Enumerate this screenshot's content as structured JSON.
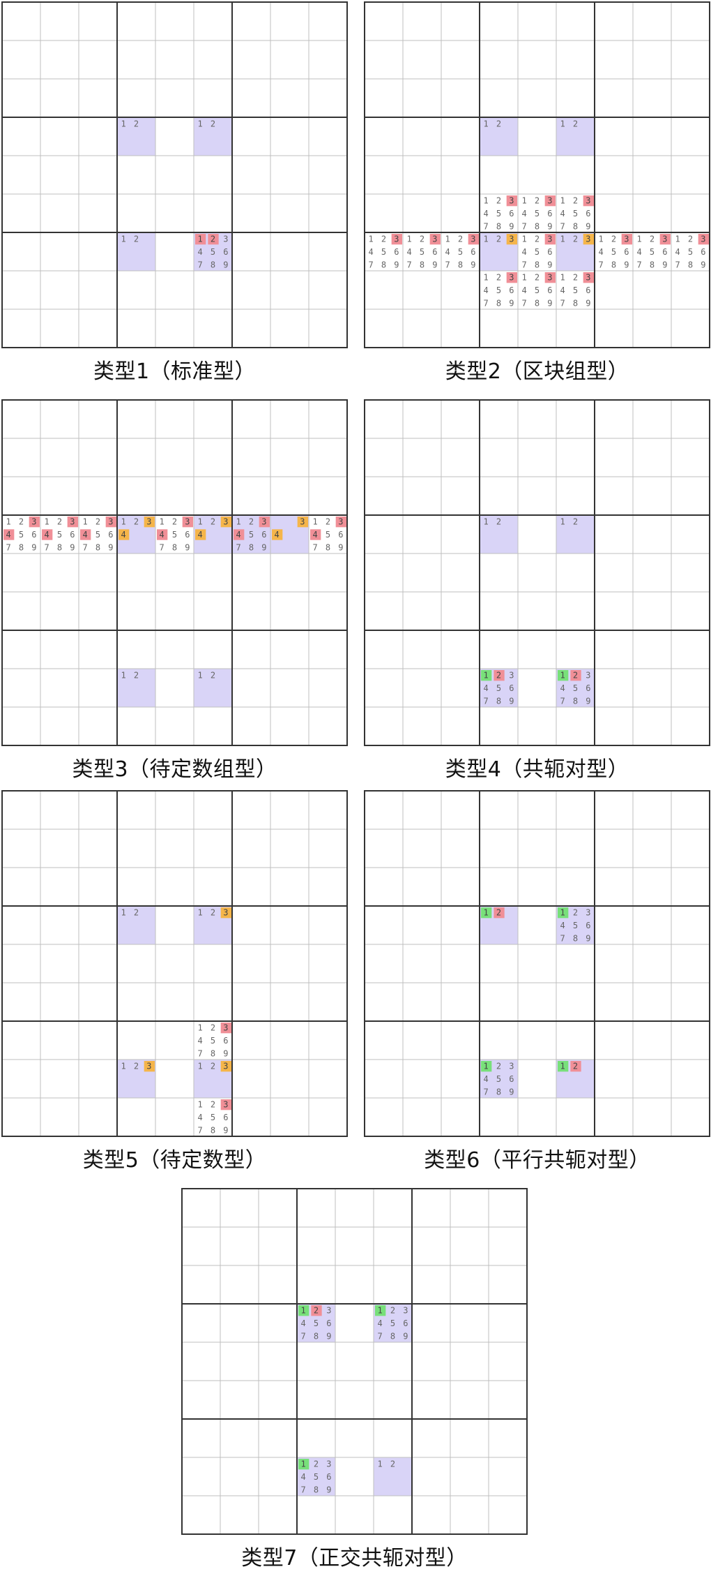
{
  "colors": {
    "highlight": "#d9d4f7",
    "red": "#f08f97",
    "orange": "#f5b54a",
    "green": "#78e07a",
    "grid_thin": "#bfbfbf",
    "grid_thick": "#333333",
    "digit": "#666666"
  },
  "panels": [
    {
      "title": "类型1（标准型）",
      "highlights": [
        [
          3,
          3
        ],
        [
          3,
          5
        ],
        [
          6,
          3
        ],
        [
          6,
          5
        ]
      ],
      "cells": [
        {
          "r": 3,
          "c": 3,
          "d": [
            1,
            2
          ]
        },
        {
          "r": 3,
          "c": 5,
          "d": [
            1,
            2
          ]
        },
        {
          "r": 6,
          "c": 3,
          "d": [
            1,
            2
          ]
        },
        {
          "r": 6,
          "c": 5,
          "d": [
            1,
            2,
            3,
            4,
            5,
            6,
            7,
            8,
            9
          ],
          "mark": {
            "1": "red",
            "2": "red"
          }
        }
      ]
    },
    {
      "title": "类型2（区块组型）",
      "highlights": [
        [
          3,
          3
        ],
        [
          3,
          5
        ],
        [
          6,
          3
        ],
        [
          6,
          5
        ]
      ],
      "cells": [
        {
          "r": 3,
          "c": 3,
          "d": [
            1,
            2
          ]
        },
        {
          "r": 3,
          "c": 5,
          "d": [
            1,
            2
          ]
        },
        {
          "r": 5,
          "c": 3,
          "d": [
            1,
            2,
            3,
            4,
            5,
            6,
            7,
            8,
            9
          ],
          "mark": {
            "3": "red"
          }
        },
        {
          "r": 5,
          "c": 4,
          "d": [
            1,
            2,
            3,
            4,
            5,
            6,
            7,
            8,
            9
          ],
          "mark": {
            "3": "red"
          }
        },
        {
          "r": 5,
          "c": 5,
          "d": [
            1,
            2,
            3,
            4,
            5,
            6,
            7,
            8,
            9
          ],
          "mark": {
            "3": "red"
          }
        },
        {
          "r": 6,
          "c": 0,
          "d": [
            1,
            2,
            3,
            4,
            5,
            6,
            7,
            8,
            9
          ],
          "mark": {
            "3": "red"
          }
        },
        {
          "r": 6,
          "c": 1,
          "d": [
            1,
            2,
            3,
            4,
            5,
            6,
            7,
            8,
            9
          ],
          "mark": {
            "3": "red"
          }
        },
        {
          "r": 6,
          "c": 2,
          "d": [
            1,
            2,
            3,
            4,
            5,
            6,
            7,
            8,
            9
          ],
          "mark": {
            "3": "red"
          }
        },
        {
          "r": 6,
          "c": 3,
          "d": [
            1,
            2,
            3
          ],
          "mark": {
            "3": "orange"
          }
        },
        {
          "r": 6,
          "c": 4,
          "d": [
            1,
            2,
            3,
            4,
            5,
            6,
            7,
            8,
            9
          ],
          "mark": {
            "3": "red"
          }
        },
        {
          "r": 6,
          "c": 5,
          "d": [
            1,
            2,
            3
          ],
          "mark": {
            "3": "orange"
          }
        },
        {
          "r": 6,
          "c": 6,
          "d": [
            1,
            2,
            3,
            4,
            5,
            6,
            7,
            8,
            9
          ],
          "mark": {
            "3": "red"
          }
        },
        {
          "r": 6,
          "c": 7,
          "d": [
            1,
            2,
            3,
            4,
            5,
            6,
            7,
            8,
            9
          ],
          "mark": {
            "3": "red"
          }
        },
        {
          "r": 6,
          "c": 8,
          "d": [
            1,
            2,
            3,
            4,
            5,
            6,
            7,
            8,
            9
          ],
          "mark": {
            "3": "red"
          }
        },
        {
          "r": 7,
          "c": 3,
          "d": [
            1,
            2,
            3,
            4,
            5,
            6,
            7,
            8,
            9
          ],
          "mark": {
            "3": "red"
          }
        },
        {
          "r": 7,
          "c": 4,
          "d": [
            1,
            2,
            3,
            4,
            5,
            6,
            7,
            8,
            9
          ],
          "mark": {
            "3": "red"
          }
        },
        {
          "r": 7,
          "c": 5,
          "d": [
            1,
            2,
            3,
            4,
            5,
            6,
            7,
            8,
            9
          ],
          "mark": {
            "3": "red"
          }
        }
      ]
    },
    {
      "title": "类型3（待定数组型）",
      "highlights": [
        [
          3,
          3
        ],
        [
          3,
          5
        ],
        [
          3,
          6
        ],
        [
          3,
          7
        ],
        [
          7,
          3
        ],
        [
          7,
          5
        ]
      ],
      "cells": [
        {
          "r": 3,
          "c": 0,
          "d": [
            1,
            2,
            3,
            4,
            5,
            6,
            7,
            8,
            9
          ],
          "mark": {
            "3": "red",
            "4": "red"
          }
        },
        {
          "r": 3,
          "c": 1,
          "d": [
            1,
            2,
            3,
            4,
            5,
            6,
            7,
            8,
            9
          ],
          "mark": {
            "3": "red",
            "4": "red"
          }
        },
        {
          "r": 3,
          "c": 2,
          "d": [
            1,
            2,
            3,
            4,
            5,
            6,
            7,
            8,
            9
          ],
          "mark": {
            "3": "red",
            "4": "red"
          }
        },
        {
          "r": 3,
          "c": 3,
          "d": [
            1,
            2,
            3,
            4
          ],
          "mark": {
            "3": "orange",
            "4": "orange"
          }
        },
        {
          "r": 3,
          "c": 4,
          "d": [
            1,
            2,
            3,
            4,
            5,
            6,
            7,
            8,
            9
          ],
          "mark": {
            "3": "red",
            "4": "red"
          }
        },
        {
          "r": 3,
          "c": 5,
          "d": [
            1,
            2,
            3,
            4
          ],
          "mark": {
            "3": "orange",
            "4": "orange"
          }
        },
        {
          "r": 3,
          "c": 6,
          "d": [
            1,
            2,
            3,
            4,
            5,
            6,
            7,
            8,
            9
          ],
          "mark": {
            "3": "red",
            "4": "red"
          }
        },
        {
          "r": 3,
          "c": 7,
          "d": [
            3,
            4
          ],
          "mark": {
            "3": "orange",
            "4": "orange"
          }
        },
        {
          "r": 3,
          "c": 8,
          "d": [
            1,
            2,
            3,
            4,
            5,
            6,
            7,
            8,
            9
          ],
          "mark": {
            "3": "red",
            "4": "red"
          }
        },
        {
          "r": 7,
          "c": 3,
          "d": [
            1,
            2
          ]
        },
        {
          "r": 7,
          "c": 5,
          "d": [
            1,
            2
          ]
        }
      ]
    },
    {
      "title": "类型4（共轭对型）",
      "highlights": [
        [
          3,
          3
        ],
        [
          3,
          5
        ],
        [
          7,
          3
        ],
        [
          7,
          5
        ]
      ],
      "cells": [
        {
          "r": 3,
          "c": 3,
          "d": [
            1,
            2
          ]
        },
        {
          "r": 3,
          "c": 5,
          "d": [
            1,
            2
          ]
        },
        {
          "r": 7,
          "c": 3,
          "d": [
            1,
            2,
            3,
            4,
            5,
            6,
            7,
            8,
            9
          ],
          "mark": {
            "1": "green",
            "2": "red"
          }
        },
        {
          "r": 7,
          "c": 5,
          "d": [
            1,
            2,
            3,
            4,
            5,
            6,
            7,
            8,
            9
          ],
          "mark": {
            "1": "green",
            "2": "red"
          }
        }
      ]
    },
    {
      "title": "类型5（待定数型）",
      "highlights": [
        [
          3,
          3
        ],
        [
          3,
          5
        ],
        [
          7,
          3
        ],
        [
          7,
          5
        ]
      ],
      "cells": [
        {
          "r": 3,
          "c": 3,
          "d": [
            1,
            2
          ]
        },
        {
          "r": 3,
          "c": 5,
          "d": [
            1,
            2,
            3
          ],
          "mark": {
            "3": "orange"
          }
        },
        {
          "r": 6,
          "c": 5,
          "d": [
            1,
            2,
            3,
            4,
            5,
            6,
            7,
            8,
            9
          ],
          "mark": {
            "3": "red"
          }
        },
        {
          "r": 7,
          "c": 3,
          "d": [
            1,
            2,
            3
          ],
          "mark": {
            "3": "orange"
          }
        },
        {
          "r": 7,
          "c": 5,
          "d": [
            1,
            2,
            3
          ],
          "mark": {
            "3": "orange"
          }
        },
        {
          "r": 8,
          "c": 5,
          "d": [
            1,
            2,
            3,
            4,
            5,
            6,
            7,
            8,
            9
          ],
          "mark": {
            "3": "red"
          }
        }
      ]
    },
    {
      "title": "类型6（平行共轭对型）",
      "highlights": [
        [
          3,
          3
        ],
        [
          3,
          5
        ],
        [
          7,
          3
        ],
        [
          7,
          5
        ]
      ],
      "cells": [
        {
          "r": 3,
          "c": 3,
          "d": [
            1,
            2
          ],
          "mark": {
            "1": "green",
            "2": "red"
          }
        },
        {
          "r": 3,
          "c": 5,
          "d": [
            1,
            2,
            3,
            4,
            5,
            6,
            7,
            8,
            9
          ],
          "mark": {
            "1": "green"
          }
        },
        {
          "r": 7,
          "c": 3,
          "d": [
            1,
            2,
            3,
            4,
            5,
            6,
            7,
            8,
            9
          ],
          "mark": {
            "1": "green"
          }
        },
        {
          "r": 7,
          "c": 5,
          "d": [
            1,
            2
          ],
          "mark": {
            "1": "green",
            "2": "red"
          }
        }
      ]
    },
    {
      "title": "类型7（正交共轭对型）",
      "highlights": [
        [
          3,
          3
        ],
        [
          3,
          5
        ],
        [
          7,
          3
        ],
        [
          7,
          5
        ]
      ],
      "cells": [
        {
          "r": 3,
          "c": 3,
          "d": [
            1,
            2,
            3,
            4,
            5,
            6,
            7,
            8,
            9
          ],
          "mark": {
            "1": "green",
            "2": "red"
          }
        },
        {
          "r": 3,
          "c": 5,
          "d": [
            1,
            2,
            3,
            4,
            5,
            6,
            7,
            8,
            9
          ],
          "mark": {
            "1": "green"
          }
        },
        {
          "r": 7,
          "c": 3,
          "d": [
            1,
            2,
            3,
            4,
            5,
            6,
            7,
            8,
            9
          ],
          "mark": {
            "1": "green"
          }
        },
        {
          "r": 7,
          "c": 5,
          "d": [
            1,
            2
          ]
        }
      ]
    }
  ]
}
